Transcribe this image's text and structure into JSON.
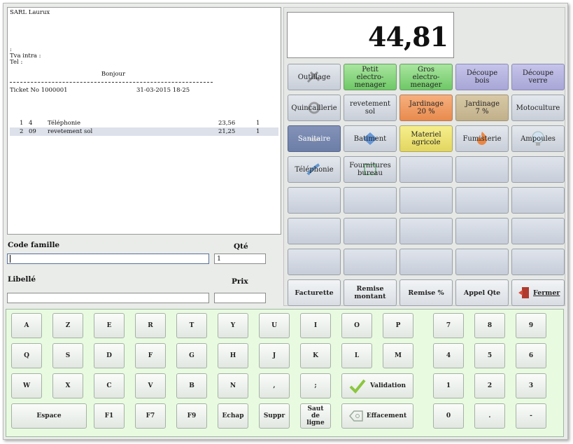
{
  "ticket": {
    "company": "SARL Laurux",
    "colon": ":",
    "tva_label": "Tva intra :",
    "tel_label": "Tel :",
    "greeting": "Bonjour",
    "ticket_no": "Ticket No 1000001",
    "datetime": "31-03-2015 18-25",
    "lines": [
      {
        "num": "1",
        "code": "4",
        "label": "Téléphonie",
        "price": "23,56",
        "qty": "1"
      },
      {
        "num": "2",
        "code": "09",
        "label": "revetement sol",
        "price": "21,25",
        "qty": "1"
      }
    ]
  },
  "form": {
    "code_famille_label": "Code famille",
    "code_famille_value": "",
    "qte_label": "Qté",
    "qte_value": "1",
    "libelle_label": "Libellé",
    "libelle_value": "",
    "prix_label": "Prix",
    "prix_value": ""
  },
  "display": {
    "amount": "44,81"
  },
  "families": [
    {
      "label": "Outillage",
      "color": "#dfe4ec",
      "icon": "tools-icon"
    },
    {
      "label": "Petit electro-menager",
      "color": "#8fd987",
      "icon": ""
    },
    {
      "label": "Gros electro-menager",
      "color": "#8fd987",
      "icon": ""
    },
    {
      "label": "Découpe bois",
      "color": "#b7b5e0",
      "icon": ""
    },
    {
      "label": "Découpe verre",
      "color": "#b7b5e0",
      "icon": ""
    },
    {
      "label": "Quincaillerie",
      "color": "#dfe4ec",
      "icon": "hardware-icon"
    },
    {
      "label": "revetement sol",
      "color": "#dfe4ec",
      "icon": ""
    },
    {
      "label": "Jardinage 20 %",
      "color": "#f09c66",
      "icon": ""
    },
    {
      "label": "Jardinage 7 %",
      "color": "#cfbf98",
      "icon": ""
    },
    {
      "label": "Motoculture",
      "color": "#dfe4ec",
      "icon": ""
    },
    {
      "label": "Sanitaire",
      "color": "#7586ad",
      "icon": "sink-icon"
    },
    {
      "label": "Batiment",
      "color": "#dfe4ec",
      "icon": "building-icon"
    },
    {
      "label": "Materiel agricole",
      "color": "#ece476",
      "icon": ""
    },
    {
      "label": "Fumisterie",
      "color": "#dfe4ec",
      "icon": "fire-icon"
    },
    {
      "label": "Ampoules",
      "color": "#dfe4ec",
      "icon": "bulb-icon"
    },
    {
      "label": "Téléphonie",
      "color": "#dfe4ec",
      "icon": "phone-icon"
    },
    {
      "label": "Fournitures bureau",
      "color": "#dfe4ec",
      "icon": "office-icon"
    }
  ],
  "actions": {
    "facturette": "Facturette",
    "remise_montant": "Remise montant",
    "remise_pct": "Remise %",
    "appel_qte": "Appel Qte",
    "fermer": "Fermer"
  },
  "keyboard": {
    "row1": [
      "A",
      "Z",
      "E",
      "R",
      "T",
      "Y",
      "U",
      "I",
      "O",
      "P"
    ],
    "row2": [
      "Q",
      "S",
      "D",
      "F",
      "G",
      "H",
      "J",
      "K",
      "L",
      "M"
    ],
    "row3": [
      "W",
      "X",
      "C",
      "V",
      "B",
      "N",
      ",",
      ";"
    ],
    "validation": "Validation",
    "espace": "Espace",
    "f1": "F1",
    "f7": "F7",
    "f9": "F9",
    "echap": "Echap",
    "suppr": "Suppr",
    "saut_de_ligne": "Saut de ligne",
    "effacement": "Effacement",
    "numpad": [
      "7",
      "8",
      "9",
      "4",
      "5",
      "6",
      "1",
      "2",
      "3",
      "0",
      ".",
      "-"
    ]
  }
}
